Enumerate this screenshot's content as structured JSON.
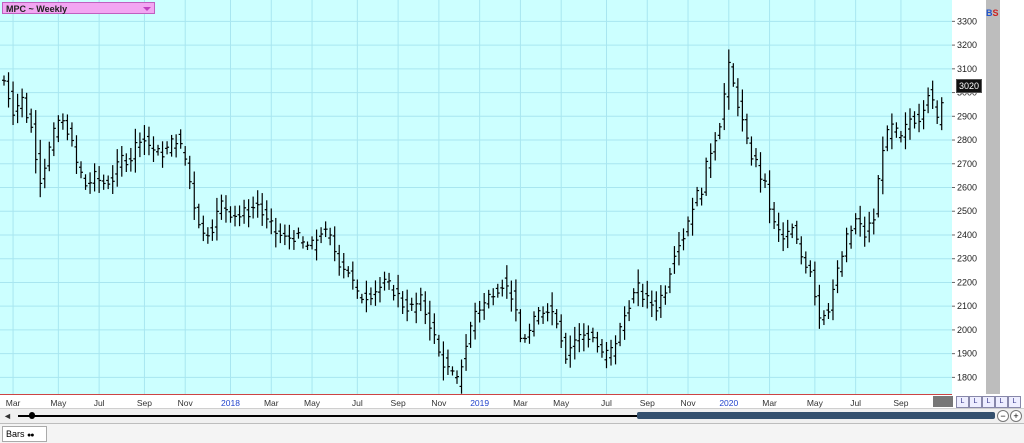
{
  "title": "MPC ~ Weekly",
  "badges": {
    "b": "B",
    "s": "S"
  },
  "last_price": "3020",
  "bottom_tab": "Bars",
  "scroll": {
    "left": "◄",
    "zoom_minus": "−",
    "zoom_plus": "+"
  },
  "small_buttons": [
    "L",
    "L",
    "L",
    "L",
    "L"
  ],
  "colors": {
    "plot_bg": "#ccffff",
    "grid": "#a8e6f0",
    "bars": "#000000",
    "year_label": "#2244cc"
  },
  "chart_data": {
    "type": "ohlc",
    "title": "MPC ~ Weekly",
    "ylim": [
      1730,
      3390
    ],
    "yticks": [
      1800,
      1900,
      2000,
      2100,
      2200,
      2300,
      2400,
      2500,
      2600,
      2700,
      2800,
      2900,
      3000,
      3100,
      3200,
      3300
    ],
    "xticks": [
      {
        "label": "Mar",
        "week": 2,
        "year": false
      },
      {
        "label": "May",
        "week": 12,
        "year": false
      },
      {
        "label": "Jul",
        "week": 21,
        "year": false
      },
      {
        "label": "Sep",
        "week": 31,
        "year": false
      },
      {
        "label": "Nov",
        "week": 40,
        "year": false
      },
      {
        "label": "2018",
        "week": 50,
        "year": true
      },
      {
        "label": "Mar",
        "week": 59,
        "year": false
      },
      {
        "label": "May",
        "week": 68,
        "year": false
      },
      {
        "label": "Jul",
        "week": 78,
        "year": false
      },
      {
        "label": "Sep",
        "week": 87,
        "year": false
      },
      {
        "label": "Nov",
        "week": 96,
        "year": false
      },
      {
        "label": "2019",
        "week": 105,
        "year": true
      },
      {
        "label": "Mar",
        "week": 114,
        "year": false
      },
      {
        "label": "May",
        "week": 123,
        "year": false
      },
      {
        "label": "Jul",
        "week": 133,
        "year": false
      },
      {
        "label": "Sep",
        "week": 142,
        "year": false
      },
      {
        "label": "Nov",
        "week": 151,
        "year": false
      },
      {
        "label": "2020",
        "week": 160,
        "year": true
      },
      {
        "label": "Mar",
        "week": 169,
        "year": false
      },
      {
        "label": "May",
        "week": 179,
        "year": false
      },
      {
        "label": "Jul",
        "week": 188,
        "year": false
      },
      {
        "label": "Sep",
        "week": 198,
        "year": false
      }
    ],
    "anchors": [
      [
        0,
        3050
      ],
      [
        2,
        2930
      ],
      [
        4,
        2970
      ],
      [
        6,
        2850
      ],
      [
        8,
        2640
      ],
      [
        10,
        2760
      ],
      [
        12,
        2880
      ],
      [
        14,
        2850
      ],
      [
        16,
        2700
      ],
      [
        18,
        2610
      ],
      [
        20,
        2640
      ],
      [
        22,
        2620
      ],
      [
        24,
        2640
      ],
      [
        26,
        2720
      ],
      [
        28,
        2730
      ],
      [
        30,
        2820
      ],
      [
        32,
        2780
      ],
      [
        34,
        2740
      ],
      [
        36,
        2760
      ],
      [
        38,
        2810
      ],
      [
        40,
        2720
      ],
      [
        42,
        2530
      ],
      [
        44,
        2400
      ],
      [
        46,
        2440
      ],
      [
        48,
        2530
      ],
      [
        50,
        2500
      ],
      [
        52,
        2480
      ],
      [
        54,
        2500
      ],
      [
        56,
        2530
      ],
      [
        58,
        2450
      ],
      [
        60,
        2410
      ],
      [
        62,
        2380
      ],
      [
        64,
        2400
      ],
      [
        66,
        2360
      ],
      [
        68,
        2350
      ],
      [
        70,
        2420
      ],
      [
        72,
        2380
      ],
      [
        74,
        2290
      ],
      [
        76,
        2250
      ],
      [
        78,
        2140
      ],
      [
        80,
        2150
      ],
      [
        82,
        2170
      ],
      [
        84,
        2190
      ],
      [
        86,
        2170
      ],
      [
        88,
        2110
      ],
      [
        90,
        2090
      ],
      [
        92,
        2120
      ],
      [
        94,
        2030
      ],
      [
        96,
        1900
      ],
      [
        98,
        1830
      ],
      [
        100,
        1780
      ],
      [
        102,
        1940
      ],
      [
        104,
        2080
      ],
      [
        106,
        2110
      ],
      [
        108,
        2170
      ],
      [
        110,
        2200
      ],
      [
        112,
        2150
      ],
      [
        114,
        1960
      ],
      [
        116,
        1990
      ],
      [
        118,
        2070
      ],
      [
        120,
        2100
      ],
      [
        122,
        2050
      ],
      [
        124,
        1900
      ],
      [
        126,
        1960
      ],
      [
        128,
        1980
      ],
      [
        130,
        1970
      ],
      [
        132,
        1890
      ],
      [
        134,
        1910
      ],
      [
        136,
        2000
      ],
      [
        138,
        2120
      ],
      [
        140,
        2170
      ],
      [
        142,
        2120
      ],
      [
        144,
        2100
      ],
      [
        146,
        2180
      ],
      [
        148,
        2340
      ],
      [
        150,
        2400
      ],
      [
        152,
        2530
      ],
      [
        154,
        2600
      ],
      [
        156,
        2760
      ],
      [
        158,
        2880
      ],
      [
        160,
        3100
      ],
      [
        162,
        2960
      ],
      [
        164,
        2780
      ],
      [
        166,
        2700
      ],
      [
        168,
        2600
      ],
      [
        170,
        2440
      ],
      [
        172,
        2380
      ],
      [
        174,
        2420
      ],
      [
        176,
        2310
      ],
      [
        178,
        2260
      ],
      [
        180,
        2060
      ],
      [
        182,
        2100
      ],
      [
        184,
        2240
      ],
      [
        186,
        2380
      ],
      [
        188,
        2460
      ],
      [
        190,
        2400
      ],
      [
        192,
        2470
      ],
      [
        194,
        2780
      ],
      [
        196,
        2850
      ],
      [
        198,
        2800
      ],
      [
        200,
        2890
      ],
      [
        202,
        2900
      ],
      [
        204,
        3010
      ],
      [
        206,
        2880
      ],
      [
        207,
        2980
      ]
    ]
  }
}
